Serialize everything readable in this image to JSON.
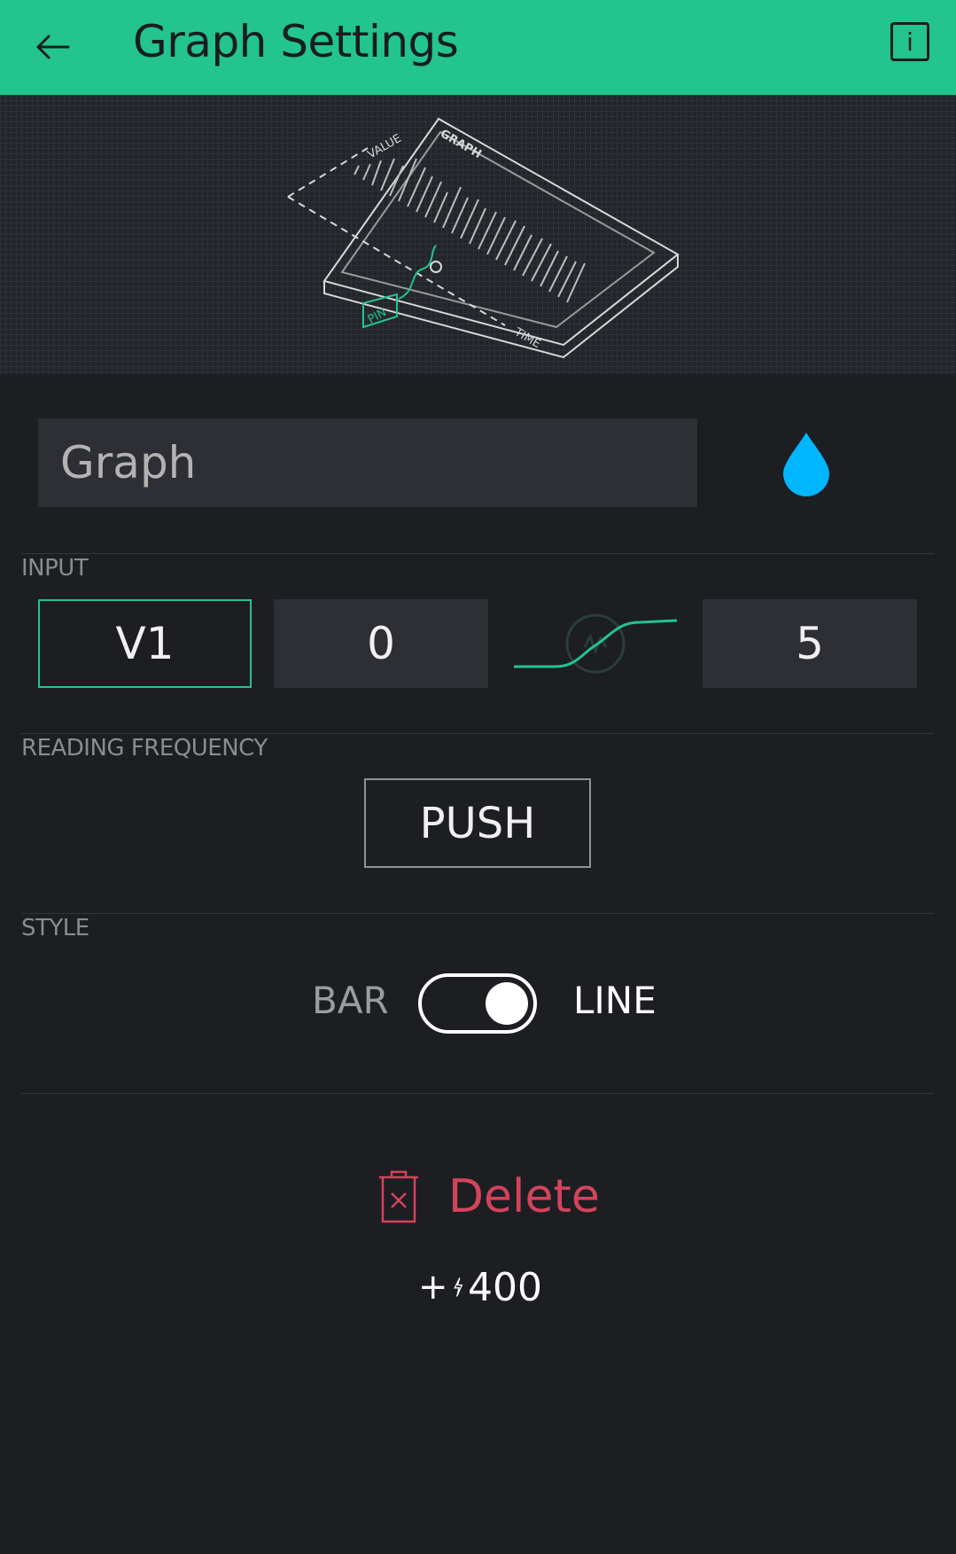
{
  "header": {
    "title": "Graph Settings",
    "back_icon": "arrow-left-icon",
    "info_label": "i",
    "background": "#23c48e"
  },
  "illustration": {
    "labels": {
      "value": "VALUE",
      "graph": "GRAPH",
      "pin": "PIN",
      "time": "TIME"
    }
  },
  "name_field": {
    "value": "",
    "placeholder": "Graph"
  },
  "color_picker": {
    "icon": "drop-icon",
    "color": "#00b6ff"
  },
  "input_section": {
    "label": "INPUT",
    "pin": "V1",
    "min": "0",
    "max": "5",
    "curve_icon": "mapping-curve-icon"
  },
  "reading_frequency": {
    "label": "READING FREQUENCY",
    "value": "PUSH"
  },
  "style": {
    "label": "STYLE",
    "option_left": "BAR",
    "option_right": "LINE",
    "selected": "LINE"
  },
  "delete": {
    "label": "Delete",
    "icon": "trash-icon",
    "color": "#d3435c"
  },
  "cost": {
    "plus": "+",
    "amount": "400",
    "icon": "energy-bolt-icon"
  }
}
